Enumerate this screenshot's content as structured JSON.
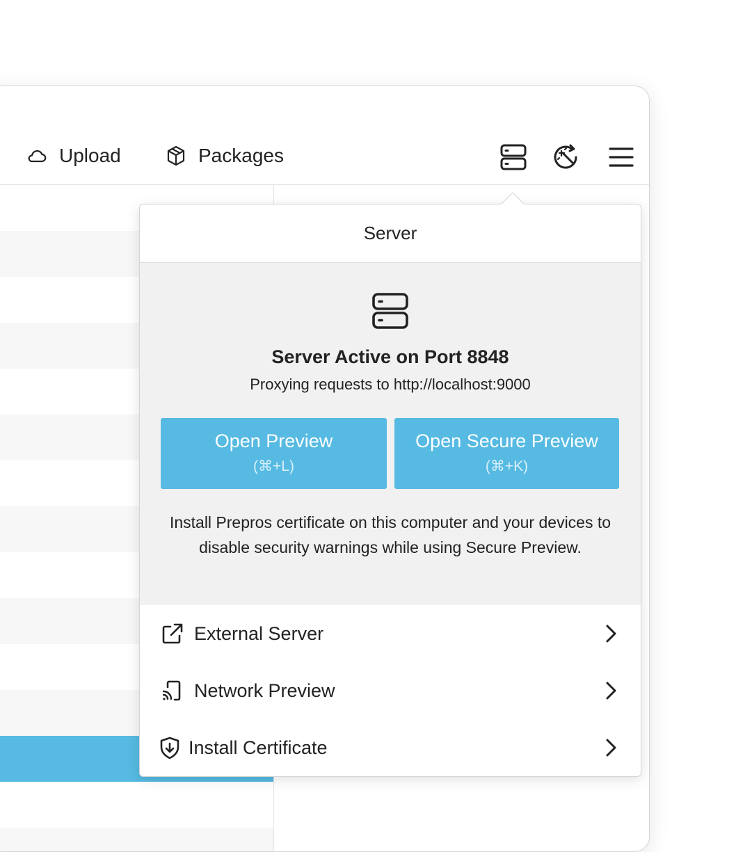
{
  "toolbar": {
    "upload_label": "Upload",
    "packages_label": "Packages",
    "icons": [
      "cloud-icon",
      "package-icon",
      "server-icon",
      "watch-icon",
      "hamburger-menu-icon"
    ]
  },
  "popover": {
    "title": "Server",
    "status_title": "Server Active on Port 8848",
    "status_subtitle": "Proxying requests to http://localhost:9000",
    "open_preview": {
      "label": "Open Preview",
      "shortcut": "(⌘+L)"
    },
    "open_secure_preview": {
      "label": "Open Secure Preview",
      "shortcut": "(⌘+K)"
    },
    "certificate_note": "Install Prepros certificate on this computer and your devices to disable security warnings while using Secure Preview.",
    "menu": [
      {
        "label": "External Server",
        "icon": "external-link-icon"
      },
      {
        "label": "Network Preview",
        "icon": "cast-device-icon"
      },
      {
        "label": "Install Certificate",
        "icon": "shield-download-icon"
      }
    ]
  },
  "colors": {
    "accent": "#56bae2",
    "panel_bg": "#f1f1f1",
    "text": "#222222"
  }
}
